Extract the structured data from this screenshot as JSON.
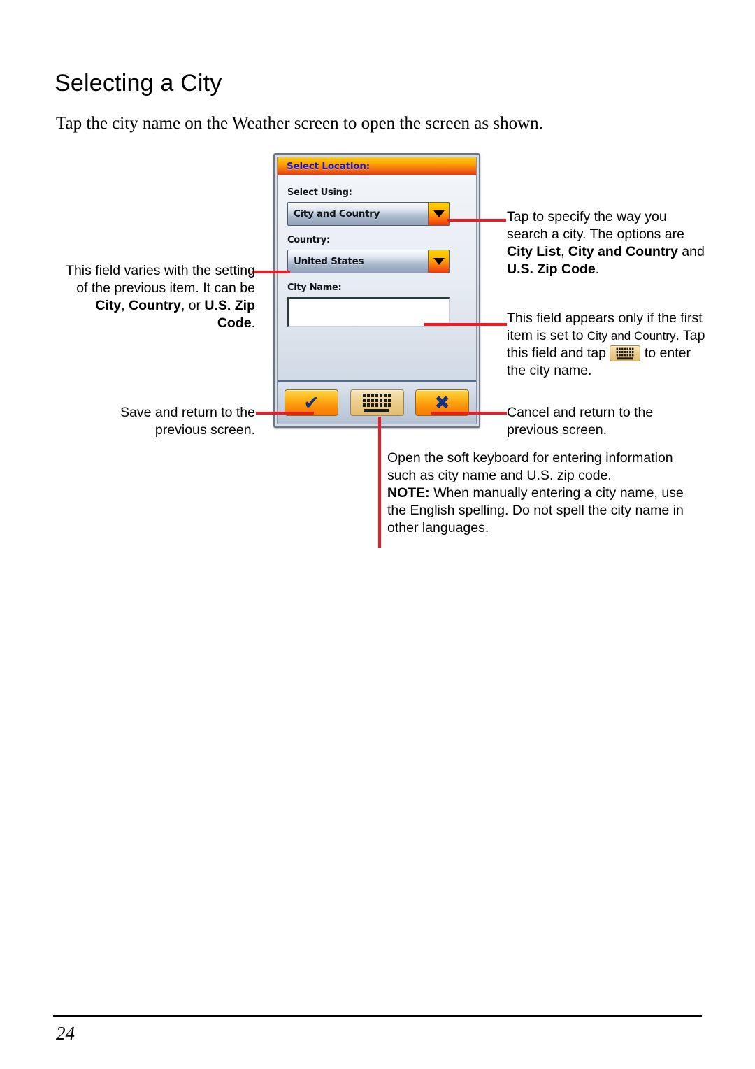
{
  "page": {
    "title": "Selecting a City",
    "intro": "Tap the city name on the Weather screen to open the screen as shown.",
    "number": "24"
  },
  "device": {
    "titlebar": "Select Location:",
    "fields": {
      "select_using_label": "Select Using:",
      "select_using_value": "City and Country",
      "country_label": "Country:",
      "country_value": "United States",
      "city_name_label": "City Name:",
      "city_name_value": ""
    },
    "toolbar": {
      "save_glyph": "✔",
      "keyboard_icon": "keyboard-icon",
      "cancel_glyph": "✖"
    },
    "colors": {
      "titlebar_top": "#ffcb1a",
      "titlebar_bottom": "#e13a0b",
      "titlebar_text": "#1b19c8",
      "button_orange": "#fb8b08",
      "button_tan": "#eccf8e",
      "glyph_navy": "#15317e",
      "callout_line": "#ed1c24"
    }
  },
  "callouts": {
    "left_field": {
      "part1": "This field varies with the setting of the previous item. It can be ",
      "bold1": "City",
      "mid1": ", ",
      "bold2": "Country",
      "mid2": ", or ",
      "bold3": "U.S. Zip Code",
      "end": "."
    },
    "left_save": "Save and return to the previous screen.",
    "right_select_using": {
      "part1": "Tap to specify the way you search a city. The options are ",
      "bold1": "City List",
      "mid1": ", ",
      "bold2": "City and Country",
      "mid2": " and ",
      "bold3": "U.S. Zip Code",
      "end": "."
    },
    "right_city_name": {
      "part1": "This field appears only if the first item is set to ",
      "small1": "City and Country",
      "part2": ". Tap this field and tap ",
      "part3": " to enter the city name."
    },
    "right_cancel": "Cancel and return to the previous screen.",
    "bottom_keyboard": {
      "part1": "Open the soft keyboard for entering information such as city name and U.S. zip code.",
      "note_label": "NOTE:",
      "note_text": " When manually entering a city name, use the English spelling. Do not spell the city name in other languages."
    }
  }
}
